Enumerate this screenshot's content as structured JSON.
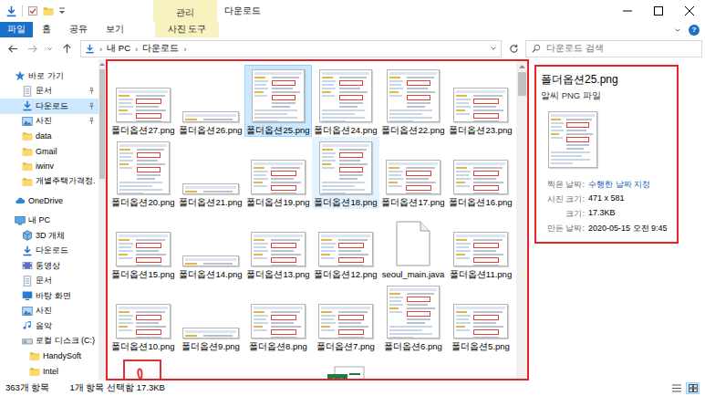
{
  "window": {
    "title": "다운로드",
    "context_tab": "관리"
  },
  "ribbon": {
    "tabs": [
      {
        "label": "파일",
        "kind": "file",
        "selected": false
      },
      {
        "label": "홈",
        "kind": "plain",
        "selected": false
      },
      {
        "label": "공유",
        "kind": "plain",
        "selected": false
      },
      {
        "label": "보기",
        "kind": "plain",
        "selected": false
      },
      {
        "label": "사진 도구",
        "kind": "context",
        "selected": false
      }
    ],
    "help": "?"
  },
  "address": {
    "separator": "›",
    "path": [
      "내 PC",
      "다운로드"
    ]
  },
  "search": {
    "placeholder": "다운로드 검색"
  },
  "nav": {
    "groups": [
      {
        "items": [
          {
            "label": "바로 가기",
            "kind": "star",
            "depth": 0,
            "selected": false,
            "pinned": false
          },
          {
            "label": "문서",
            "kind": "docs",
            "depth": 1,
            "selected": false,
            "pinned": true
          },
          {
            "label": "다운로드",
            "kind": "download",
            "depth": 1,
            "selected": true,
            "pinned": true
          },
          {
            "label": "사진",
            "kind": "pictures",
            "depth": 1,
            "selected": false,
            "pinned": true
          },
          {
            "label": "data",
            "kind": "folder",
            "depth": 1,
            "selected": false,
            "pinned": false
          },
          {
            "label": "Gmail",
            "kind": "folder",
            "depth": 1,
            "selected": false,
            "pinned": false
          },
          {
            "label": "iwinv",
            "kind": "folder",
            "depth": 1,
            "selected": false,
            "pinned": false
          },
          {
            "label": "개별주택가격정.",
            "kind": "folder",
            "depth": 1,
            "selected": false,
            "pinned": false
          }
        ]
      },
      {
        "items": [
          {
            "label": "OneDrive",
            "kind": "cloud",
            "depth": 0,
            "selected": false,
            "pinned": false
          }
        ]
      },
      {
        "items": [
          {
            "label": "내 PC",
            "kind": "pc",
            "depth": 0,
            "selected": false,
            "pinned": false
          },
          {
            "label": "3D 개체",
            "kind": "cube",
            "depth": 1,
            "selected": false,
            "pinned": false
          },
          {
            "label": "다운로드",
            "kind": "download",
            "depth": 1,
            "selected": false,
            "pinned": false
          },
          {
            "label": "동영상",
            "kind": "video",
            "depth": 1,
            "selected": false,
            "pinned": false
          },
          {
            "label": "문서",
            "kind": "docs",
            "depth": 1,
            "selected": false,
            "pinned": false
          },
          {
            "label": "바탕 화면",
            "kind": "desktop",
            "depth": 1,
            "selected": false,
            "pinned": false
          },
          {
            "label": "사진",
            "kind": "pictures",
            "depth": 1,
            "selected": false,
            "pinned": false
          },
          {
            "label": "음악",
            "kind": "music",
            "depth": 1,
            "selected": false,
            "pinned": false
          },
          {
            "label": "로컬 디스크 (C:)",
            "kind": "drive",
            "depth": 1,
            "selected": false,
            "pinned": false
          },
          {
            "label": "HandySoft",
            "kind": "folder",
            "depth": 2,
            "selected": false,
            "pinned": false
          },
          {
            "label": "Intel",
            "kind": "folder",
            "depth": 2,
            "selected": false,
            "pinned": false
          }
        ]
      }
    ]
  },
  "files": [
    {
      "name": "폴더옵션27.png",
      "kind": "mid",
      "selected": false,
      "hot": false
    },
    {
      "name": "폴더옵션26.png",
      "kind": "strip",
      "selected": false,
      "hot": false
    },
    {
      "name": "폴더옵션25.png",
      "kind": "square",
      "selected": true,
      "hot": false
    },
    {
      "name": "폴더옵션24.png",
      "kind": "square",
      "selected": false,
      "hot": false
    },
    {
      "name": "폴더옵션22.png",
      "kind": "square",
      "selected": false,
      "hot": false
    },
    {
      "name": "폴더옵션23.png",
      "kind": "mid",
      "selected": false,
      "hot": false
    },
    {
      "name": "폴더옵션20.png",
      "kind": "square",
      "selected": false,
      "hot": false
    },
    {
      "name": "폴더옵션21.png",
      "kind": "strip",
      "selected": false,
      "hot": false
    },
    {
      "name": "폴더옵션19.png",
      "kind": "mid",
      "selected": false,
      "hot": false
    },
    {
      "name": "폴더옵션18.png",
      "kind": "square",
      "selected": false,
      "hot": true
    },
    {
      "name": "폴더옵션17.png",
      "kind": "mid",
      "selected": false,
      "hot": false
    },
    {
      "name": "폴더옵션16.png",
      "kind": "mid",
      "selected": false,
      "hot": false
    },
    {
      "name": "폴더옵션15.png",
      "kind": "mid",
      "selected": false,
      "hot": false
    },
    {
      "name": "폴더옵션14.png",
      "kind": "strip",
      "selected": false,
      "hot": false
    },
    {
      "name": "폴더옵션13.png",
      "kind": "mid",
      "selected": false,
      "hot": false
    },
    {
      "name": "폴더옵션12.png",
      "kind": "mid",
      "selected": false,
      "hot": false
    },
    {
      "name": "seoul_main.java",
      "kind": "doc",
      "selected": false,
      "hot": false
    },
    {
      "name": "폴더옵션11.png",
      "kind": "mid",
      "selected": false,
      "hot": false
    },
    {
      "name": "폴더옵션10.png",
      "kind": "mid",
      "selected": false,
      "hot": false
    },
    {
      "name": "폴더옵션9.png",
      "kind": "strip",
      "selected": false,
      "hot": false
    },
    {
      "name": "폴더옵션8.png",
      "kind": "mid",
      "selected": false,
      "hot": false
    },
    {
      "name": "폴더옵션7.png",
      "kind": "mid",
      "selected": false,
      "hot": false
    },
    {
      "name": "폴더옵션6.png",
      "kind": "square",
      "selected": false,
      "hot": false
    },
    {
      "name": "폴더옵션5.png",
      "kind": "mid",
      "selected": false,
      "hot": false
    }
  ],
  "files_cut_off": [
    {
      "kind": "pdf"
    },
    {
      "kind": "blank"
    },
    {
      "kind": "blank"
    },
    {
      "kind": "excel"
    },
    {
      "kind": "blank"
    },
    {
      "kind": "blank"
    }
  ],
  "details": {
    "name": "폴더옵션25.png",
    "type": "알씨 PNG 파일",
    "properties": [
      {
        "label": "찍은 날짜:",
        "value": "수행한 날짜 지정",
        "kind": "link"
      },
      {
        "label": "사진 크기:",
        "value": "471 x 581",
        "kind": "plain"
      },
      {
        "label": "크기:",
        "value": "17.3KB",
        "kind": "plain"
      },
      {
        "label": "만든 날짜:",
        "value": "2020-05-15 오전 9:45",
        "kind": "plain"
      }
    ]
  },
  "status_bar": {
    "items": [
      "363개 항목",
      "1개 항목 선택함 17.3KB"
    ],
    "views": [
      {
        "kind": "details",
        "selected": false
      },
      {
        "kind": "large-icons",
        "selected": true
      }
    ]
  }
}
